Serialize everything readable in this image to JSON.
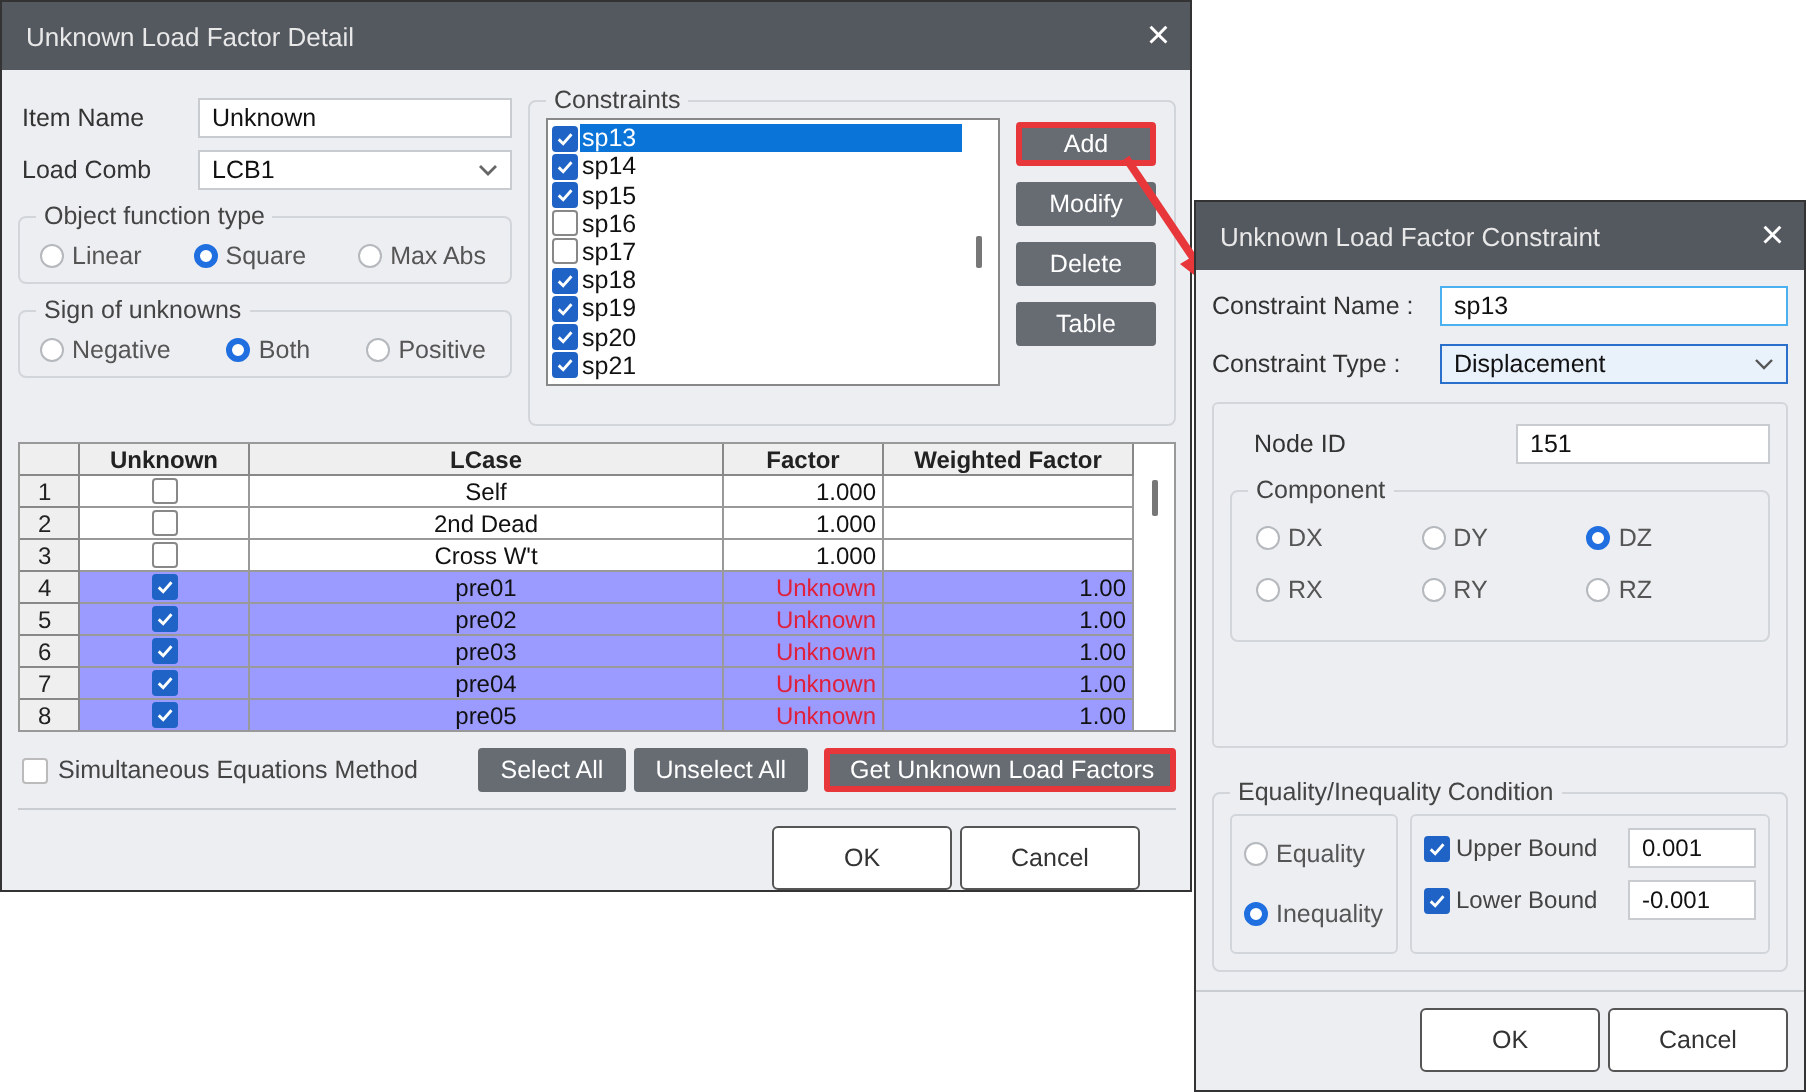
{
  "main_dialog": {
    "title": "Unknown Load Factor Detail",
    "close": "×",
    "item_name": {
      "label": "Item Name",
      "value": "Unknown"
    },
    "load_comb": {
      "label": "Load Comb",
      "value": "LCB1"
    },
    "object_function": {
      "title": "Object function type",
      "options": [
        {
          "label": "Linear",
          "selected": false
        },
        {
          "label": "Square",
          "selected": true
        },
        {
          "label": "Max Abs",
          "selected": false
        }
      ]
    },
    "sign": {
      "title": "Sign of unknowns",
      "options": [
        {
          "label": "Negative",
          "selected": false
        },
        {
          "label": "Both",
          "selected": true
        },
        {
          "label": "Positive",
          "selected": false
        }
      ]
    },
    "constraints": {
      "title": "Constraints",
      "items": [
        {
          "label": "sp13",
          "checked": true,
          "selected": true
        },
        {
          "label": "sp14",
          "checked": true,
          "selected": false
        },
        {
          "label": "sp15",
          "checked": true,
          "selected": false
        },
        {
          "label": "sp16",
          "checked": false,
          "selected": false
        },
        {
          "label": "sp17",
          "checked": false,
          "selected": false
        },
        {
          "label": "sp18",
          "checked": true,
          "selected": false
        },
        {
          "label": "sp19",
          "checked": true,
          "selected": false
        },
        {
          "label": "sp20",
          "checked": true,
          "selected": false
        },
        {
          "label": "sp21",
          "checked": true,
          "selected": false
        }
      ]
    },
    "side_buttons": [
      {
        "label": "Add",
        "highlighted": true
      },
      {
        "label": "Modify",
        "highlighted": false
      },
      {
        "label": "Delete",
        "highlighted": false
      },
      {
        "label": "Table",
        "highlighted": false
      }
    ],
    "table": {
      "columns": [
        "Unknown",
        "LCase",
        "Factor",
        "Weighted Factor"
      ],
      "rows": [
        {
          "number": "1",
          "checked": false,
          "lcase": "Self",
          "factor": "1.000",
          "weighted": ""
        },
        {
          "number": "2",
          "checked": false,
          "lcase": "2nd Dead",
          "factor": "1.000",
          "weighted": ""
        },
        {
          "number": "3",
          "checked": false,
          "lcase": "Cross W't",
          "factor": "1.000",
          "weighted": ""
        },
        {
          "number": "4",
          "checked": true,
          "lcase": "pre01",
          "factor": "Unknown",
          "weighted": "1.00"
        },
        {
          "number": "5",
          "checked": true,
          "lcase": "pre02",
          "factor": "Unknown",
          "weighted": "1.00"
        },
        {
          "number": "6",
          "checked": true,
          "lcase": "pre03",
          "factor": "Unknown",
          "weighted": "1.00"
        },
        {
          "number": "7",
          "checked": true,
          "lcase": "pre04",
          "factor": "Unknown",
          "weighted": "1.00"
        },
        {
          "number": "8",
          "checked": true,
          "lcase": "pre05",
          "factor": "Unknown",
          "weighted": "1.00"
        }
      ]
    },
    "simultaneous": {
      "label": "Simultaneous Equations Method",
      "checked": false
    },
    "action_buttons": [
      {
        "label": "Select All",
        "highlighted": false
      },
      {
        "label": "Unselect All",
        "highlighted": false
      },
      {
        "label": "Get Unknown Load Factors",
        "highlighted": true
      }
    ],
    "footer_buttons": [
      "OK",
      "Cancel"
    ]
  },
  "constraint_dialog": {
    "title": "Unknown Load Factor Constraint",
    "close": "×",
    "name": {
      "label": "Constraint Name :",
      "value": "sp13"
    },
    "type": {
      "label": "Constraint Type :",
      "value": "Displacement"
    },
    "node": {
      "label": "Node ID",
      "value": "151"
    },
    "component": {
      "title": "Component",
      "options": [
        {
          "label": "DX",
          "selected": false
        },
        {
          "label": "DY",
          "selected": false
        },
        {
          "label": "DZ",
          "selected": true
        },
        {
          "label": "RX",
          "selected": false
        },
        {
          "label": "RY",
          "selected": false
        },
        {
          "label": "RZ",
          "selected": false
        }
      ]
    },
    "condition": {
      "title": "Equality/Inequality Condition",
      "options": [
        {
          "label": "Equality",
          "selected": false
        },
        {
          "label": "Inequality",
          "selected": true
        }
      ],
      "bounds": [
        {
          "label": "Upper Bound",
          "checked": true,
          "value": "0.001"
        },
        {
          "label": "Lower Bound",
          "checked": true,
          "value": "-0.001"
        }
      ]
    },
    "footer_buttons": [
      "OK",
      "Cancel"
    ]
  }
}
